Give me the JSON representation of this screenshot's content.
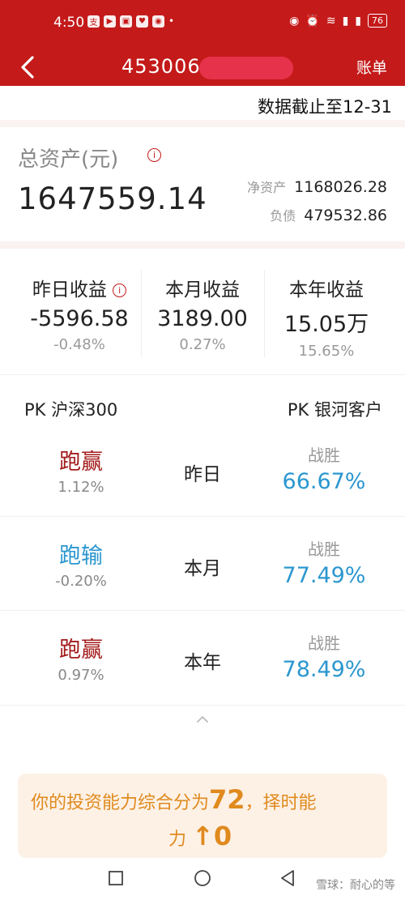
{
  "status_bar": {
    "time": "4:50",
    "battery": "76"
  },
  "header": {
    "account_id": "4530060",
    "bill_label": "账单"
  },
  "cutoff_text": "数据截止至12-31",
  "assets": {
    "label": "总资产(元)",
    "total": "1647559.14",
    "net_label": "净资产",
    "net_value": "1168026.28",
    "debt_label": "负债",
    "debt_value": "479532.86"
  },
  "earnings": [
    {
      "label": "昨日收益",
      "value": "-5596.58",
      "pct": "-0.48%"
    },
    {
      "label": "本月收益",
      "value": "3189.00",
      "pct": "0.27%"
    },
    {
      "label": "本年收益",
      "value": "15.05万",
      "pct": "15.65%"
    }
  ],
  "pk": {
    "left_header": "PK 沪深300",
    "right_header": "PK 银河客户",
    "rows": [
      {
        "result": "跑赢",
        "result_color": "#a31b1b",
        "diff": "1.12%",
        "period": "昨日",
        "win_label": "战胜",
        "win_pct": "66.67%"
      },
      {
        "result": "跑输",
        "result_color": "#2b97cf",
        "diff": "-0.20%",
        "period": "本月",
        "win_label": "战胜",
        "win_pct": "77.49%"
      },
      {
        "result": "跑赢",
        "result_color": "#a31b1b",
        "diff": "0.97%",
        "period": "本年",
        "win_label": "战胜",
        "win_pct": "78.49%"
      }
    ]
  },
  "banner": {
    "line1_prefix": "你的投资能力综合分为",
    "score": "72",
    "line1_suffix": "，择时能",
    "line2_prefix": "力",
    "arrow": "↑",
    "timing_level": "0"
  },
  "watermark": "雪球：耐心的等",
  "colors": {
    "brand_red": "#c41a1a",
    "win_blue": "#2b97cf",
    "accent_orange": "#e08a1e"
  }
}
